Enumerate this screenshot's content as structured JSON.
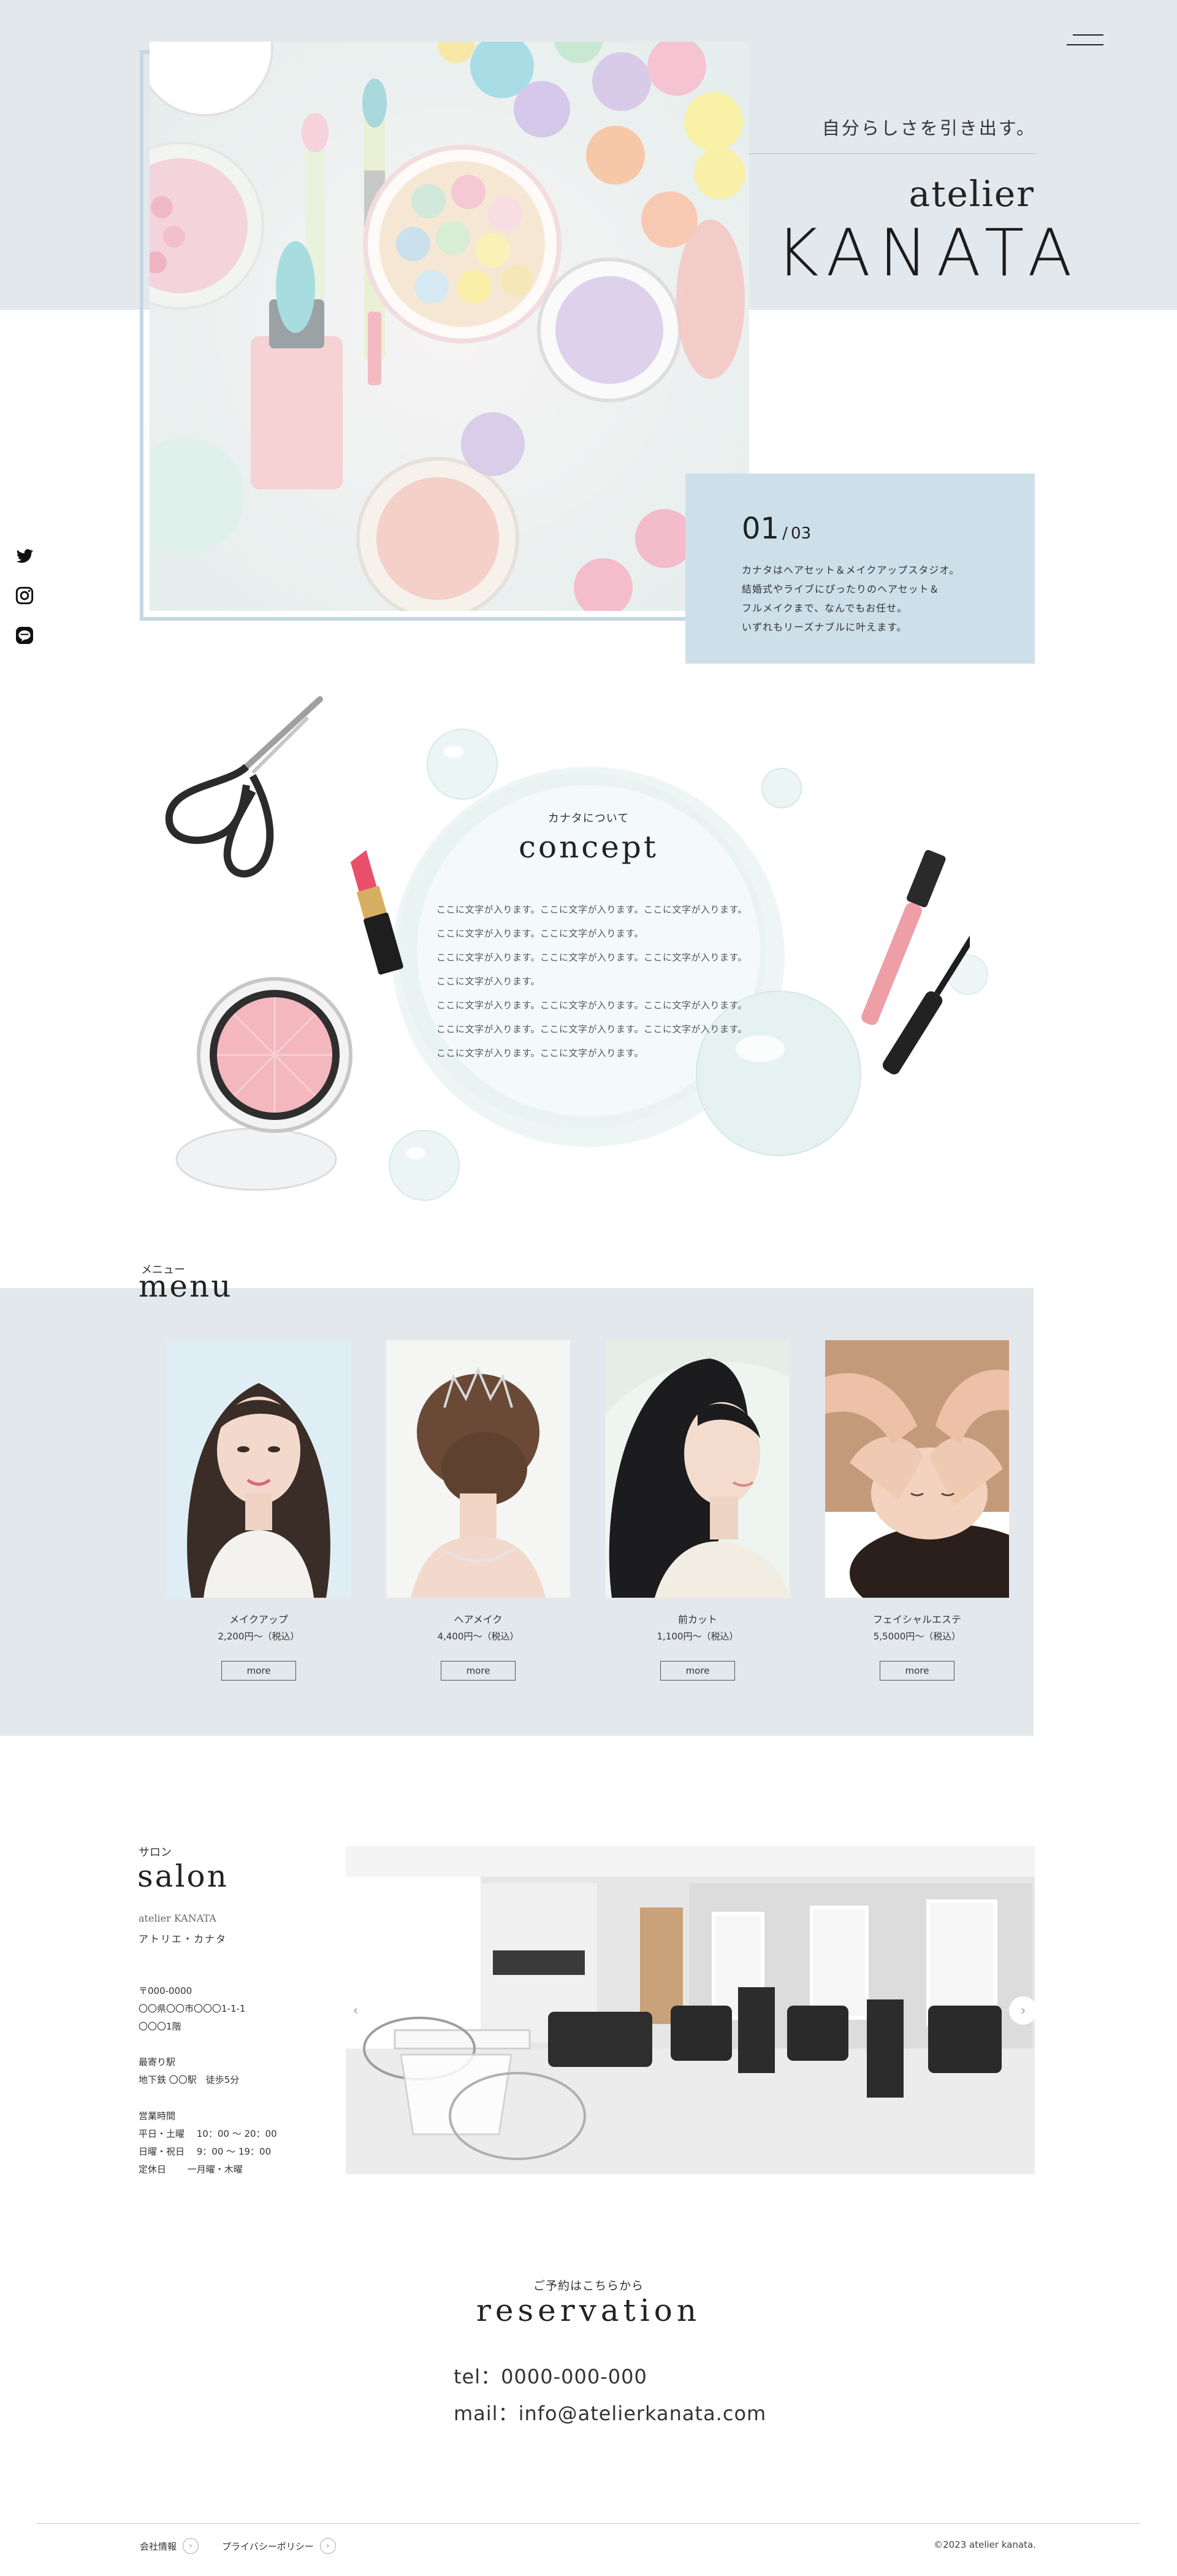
{
  "header": {
    "tagline": "自分らしさを引き出す。",
    "brand_line1": "atelier",
    "brand_line2": "KANATA"
  },
  "hero": {
    "slide_current": "01",
    "slide_separator": "/",
    "slide_total": "03",
    "slide_text": [
      "カナタはヘアセット＆メイクアップスタジオ。",
      "結婚式やライブにぴったりのヘアセット＆",
      "フルメイクまで、なんでもお任せ。",
      "いずれもリーズナブルに叶えます。"
    ]
  },
  "social": [
    "twitter-icon",
    "instagram-icon",
    "line-icon"
  ],
  "concept": {
    "title_jp": "カナタについて",
    "title": "concept",
    "body": [
      "ここに文字が入ります。ここに文字が入ります。ここに文字が入ります。",
      "ここに文字が入ります。ここに文字が入ります。",
      "ここに文字が入ります。ここに文字が入ります。ここに文字が入ります。",
      "ここに文字が入ります。",
      "ここに文字が入ります。ここに文字が入ります。ここに文字が入ります。",
      "ここに文字が入ります。ここに文字が入ります。ここに文字が入ります。",
      "ここに文字が入ります。ここに文字が入ります。"
    ]
  },
  "menu": {
    "title_jp": "メニュー",
    "title": "menu",
    "items": [
      {
        "name": "メイクアップ",
        "price": "2,200円〜（税込）",
        "button": "more"
      },
      {
        "name": "ヘアメイク",
        "price": "4,400円〜（税込）",
        "button": "more"
      },
      {
        "name": "前カット",
        "price": "1,100円〜（税込）",
        "button": "more"
      },
      {
        "name": "フェイシャルエステ",
        "price": "5,5000円〜（税込）",
        "button": "more"
      }
    ]
  },
  "salon": {
    "title_jp": "サロン",
    "title": "salon",
    "logo": "atelier KANATA",
    "kana": "アトリエ・カナタ",
    "address": [
      "〒000-0000",
      "〇〇県〇〇市〇〇〇1-1-1",
      "〇〇〇1階"
    ],
    "station": [
      "最寄り駅",
      "地下鉄 〇〇駅　徒歩5分"
    ],
    "hours": [
      "営業時間",
      "平日・土曜　  10：00 ～ 20：00",
      "日曜・祝日　  9：00 ～ 19：00",
      "定休日　　 一月曜・木曜"
    ],
    "prev_arrow": "‹",
    "next_arrow": "›"
  },
  "reservation": {
    "title_jp": "ご予約はこちらから",
    "title": "reservation",
    "tel": "tel：0000-000-000",
    "mail": "mail：info@atelierkanata.com"
  },
  "footer": {
    "link1": "会社情報",
    "link2": "プライバシーポリシー",
    "link_arrow": "›",
    "copyright": "©2023 atelier kanata."
  },
  "colors": {
    "band": "#e3e8ed",
    "card": "#cde0ea",
    "frame": "#c6d6e4",
    "text": "#333333"
  }
}
